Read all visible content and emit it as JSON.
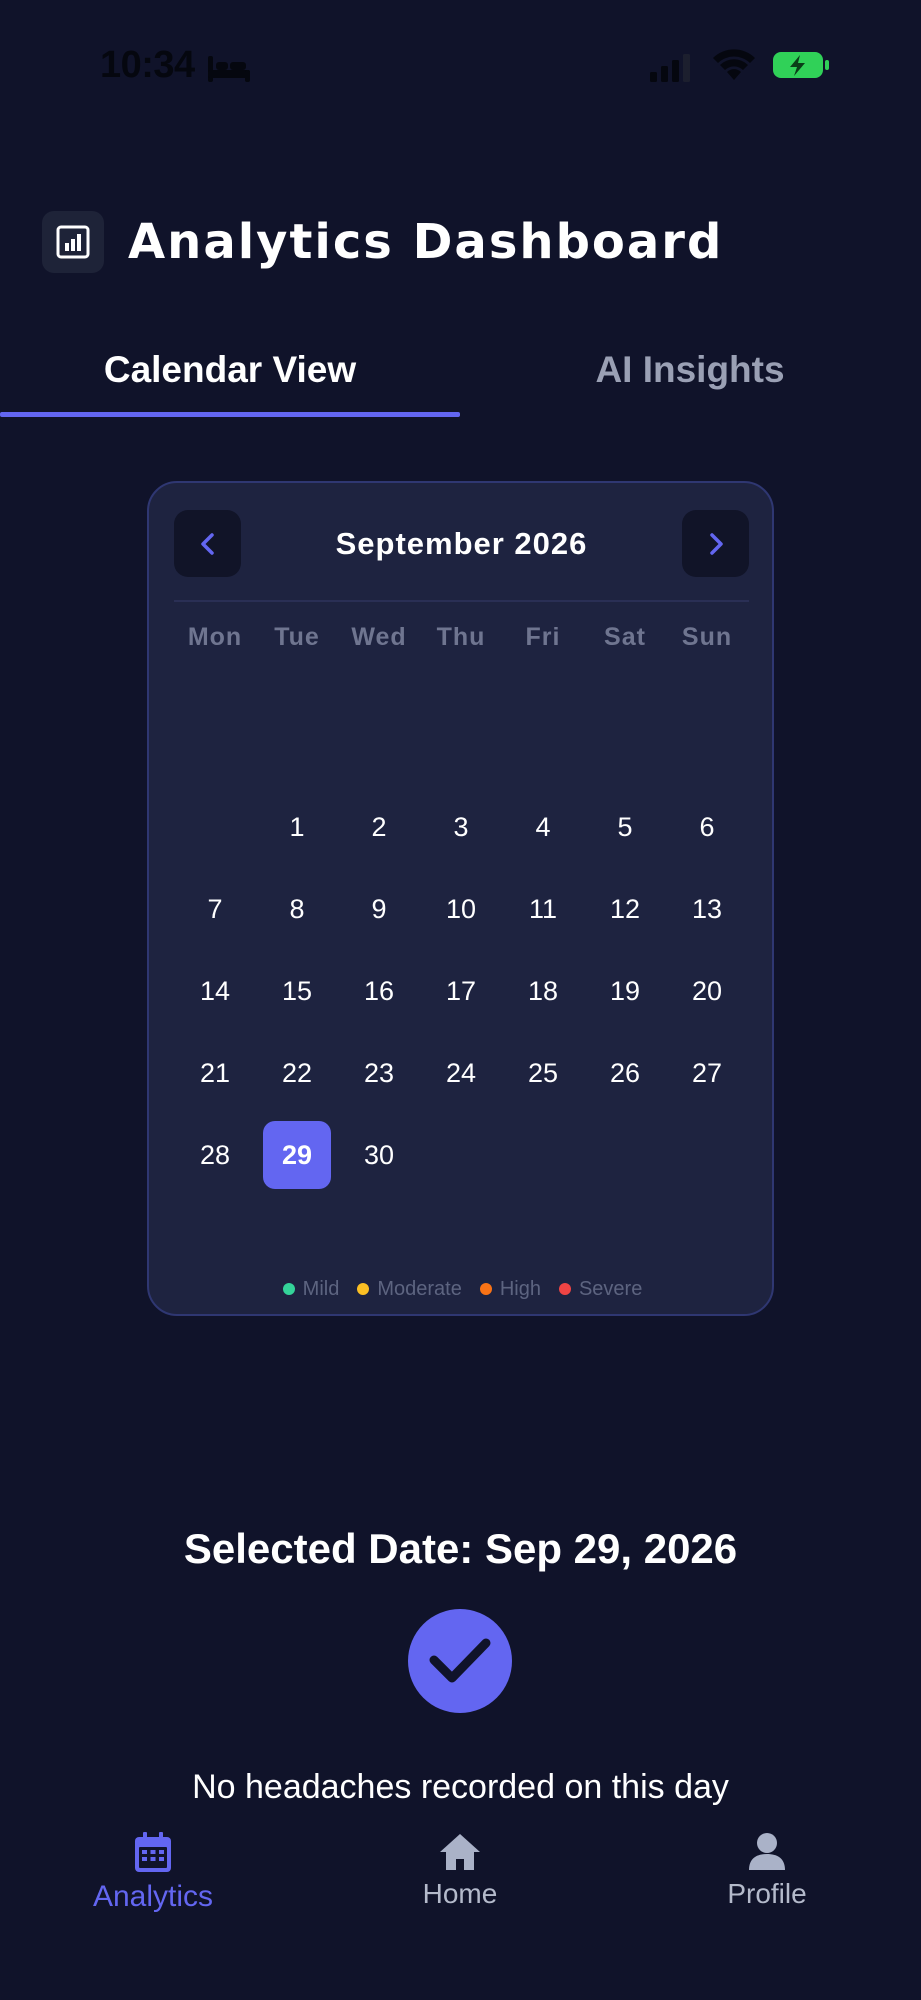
{
  "status_bar": {
    "time": "10:34",
    "icons": [
      "bed-icon",
      "signal-icon",
      "wifi-icon",
      "battery-charging-icon"
    ]
  },
  "header": {
    "icon": "bar-chart-icon",
    "title": "Analytics Dashboard"
  },
  "tabs": [
    {
      "label": "Calendar View",
      "active": true
    },
    {
      "label": "AI Insights",
      "active": false
    }
  ],
  "calendar": {
    "title": "September 2026",
    "prev_icon": "chevron-left-icon",
    "next_icon": "chevron-right-icon",
    "weekdays": [
      "Mon",
      "Tue",
      "Wed",
      "Thu",
      "Fri",
      "Sat",
      "Sun"
    ],
    "weeks": [
      [
        "",
        "1",
        "2",
        "3",
        "4",
        "5",
        "6"
      ],
      [
        "7",
        "8",
        "9",
        "10",
        "11",
        "12",
        "13"
      ],
      [
        "14",
        "15",
        "16",
        "17",
        "18",
        "19",
        "20"
      ],
      [
        "21",
        "22",
        "23",
        "24",
        "25",
        "26",
        "27"
      ],
      [
        "28",
        "29",
        "30",
        "",
        "",
        "",
        ""
      ]
    ],
    "selected_day": "29",
    "legend": [
      {
        "label": "Mild",
        "color": "#34d399"
      },
      {
        "label": "Moderate",
        "color": "#fbbf24"
      },
      {
        "label": "High",
        "color": "#f97316"
      },
      {
        "label": "Severe",
        "color": "#ef4444"
      }
    ]
  },
  "selected": {
    "label": "Selected Date: Sep 29, 2026",
    "icon": "check-icon",
    "message": "No headaches recorded on this day"
  },
  "bottom_nav": [
    {
      "label": "Analytics",
      "icon": "calendar-icon",
      "active": true
    },
    {
      "label": "Home",
      "icon": "home-icon",
      "active": false
    },
    {
      "label": "Profile",
      "icon": "person-icon",
      "active": false
    }
  ],
  "colors": {
    "background": "#10132a",
    "accent": "#6366f1",
    "card": "#1e2340"
  }
}
